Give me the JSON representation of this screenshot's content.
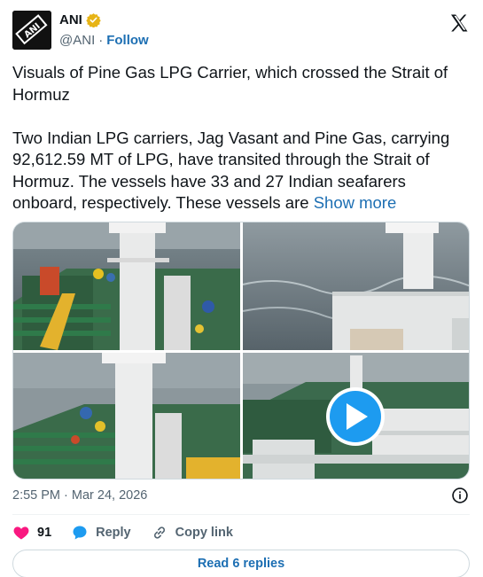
{
  "author": {
    "display_name": "ANI",
    "handle": "@ANI",
    "separator": "·",
    "follow_label": "Follow",
    "avatar_text": "ANI",
    "verified_color": "#e7b416"
  },
  "tweet": {
    "text_line1": "Visuals of Pine Gas LPG Carrier, which crossed the Strait of Hormuz",
    "text_body": "Two Indian LPG carriers, Jag Vasant and Pine Gas, carrying 92,612.59 MT of LPG, have transited through the Strait of Hormuz. The vessels have 33 and 27 Indian seafarers onboard, respectively. These vessels are ",
    "show_more_label": "Show more",
    "timestamp": "2:55 PM · Mar 24, 2026"
  },
  "media": {
    "images": [
      {
        "description_icon": "ship-deck-image"
      },
      {
        "description_icon": "sea-mast-image"
      },
      {
        "description_icon": "ship-deck-image"
      },
      {
        "description_icon": "video-thumbnail-image"
      }
    ],
    "has_play_button": true
  },
  "actions": {
    "like_count": "91",
    "reply_label": "Reply",
    "copy_link_label": "Copy link"
  },
  "replies_button_label": "Read 6 replies",
  "colors": {
    "accent": "#1d6fb3",
    "like": "#f91880",
    "secondary_text": "#536471",
    "border": "#cfd9de"
  }
}
